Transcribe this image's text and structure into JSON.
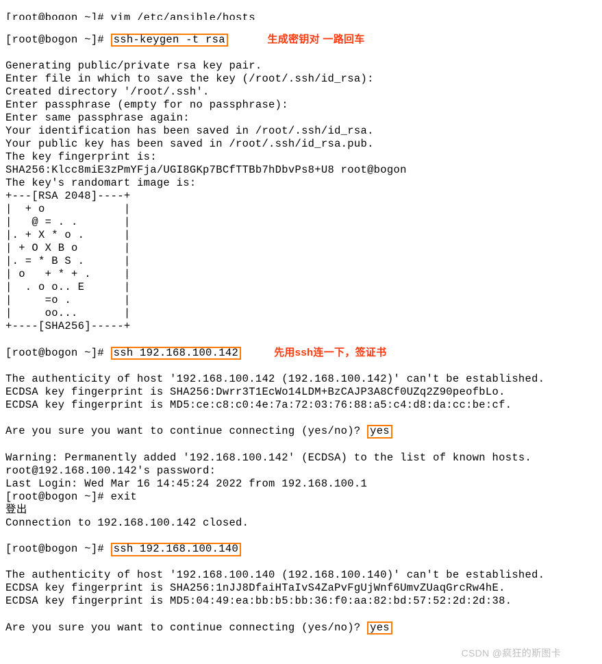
{
  "prompt_root": "[root@bogon ~]# ",
  "cmd_vim_partial": "[root@bogon ~]# vim /etc/ansible/hosts",
  "cmd1": "ssh-keygen -t rsa",
  "anno1": "生成密钥对 一路回车",
  "lines_keygen": [
    "Generating public/private rsa key pair.",
    "Enter file in which to save the key (/root/.ssh/id_rsa):",
    "Created directory '/root/.ssh'.",
    "Enter passphrase (empty for no passphrase):",
    "Enter same passphrase again:",
    "Your identification has been saved in /root/.ssh/id_rsa.",
    "Your public key has been saved in /root/.ssh/id_rsa.pub.",
    "The key fingerprint is:",
    "SHA256:Klcc8miE3zPmYFja/UGI8GKp7BCfTTBb7hDbvPs8+U8 root@bogon",
    "The key's randomart image is:",
    "+---[RSA 2048]----+",
    "|  + o            |",
    "|   @ = . .       |",
    "|. + X * o .      |",
    "| + O X B o       |",
    "|. = * B S .      |",
    "| o   + * + .     |",
    "|  . o o.. E      |",
    "|     =o .        |",
    "|     oo...       |",
    "+----[SHA256]-----+"
  ],
  "cmd2": "ssh 192.168.100.142",
  "anno2": "先用ssh连一下，签证书",
  "lines_ssh1_a": [
    "The authenticity of host '192.168.100.142 (192.168.100.142)' can't be established.",
    "ECDSA key fingerprint is SHA256:Dwrr3T1EcWo14LDM+BzCAJP3A8Cf0UZq2Z90peofbLo.",
    "ECDSA key fingerprint is MD5:ce:c8:c0:4e:7a:72:03:76:88:a5:c4:d8:da:cc:be:cf."
  ],
  "confirm_q": "Are you sure you want to continue connecting (yes/no)? ",
  "confirm_a": "yes",
  "lines_ssh1_b": [
    "Warning: Permanently added '192.168.100.142' (ECDSA) to the list of known hosts.",
    "root@192.168.100.142's password:",
    "Last Login: Wed Mar 16 14:45:24 2022 from 192.168.100.1",
    "[root@bogon ~]# exit",
    "登出",
    "Connection to 192.168.100.142 closed."
  ],
  "cmd3": "ssh 192.168.100.140",
  "lines_ssh2": [
    "The authenticity of host '192.168.100.140 (192.168.100.140)' can't be established.",
    "ECDSA key fingerprint is SHA256:1nJJ8DfaiHTaIvS4ZaPvFgUjWnf6UmvZUaqGrcRw4hE.",
    "ECDSA key fingerprint is MD5:04:49:ea:bb:b5:bb:36:f0:aa:82:bd:57:52:2d:2d:38."
  ],
  "watermark": "CSDN @疯狂的斯图卡"
}
